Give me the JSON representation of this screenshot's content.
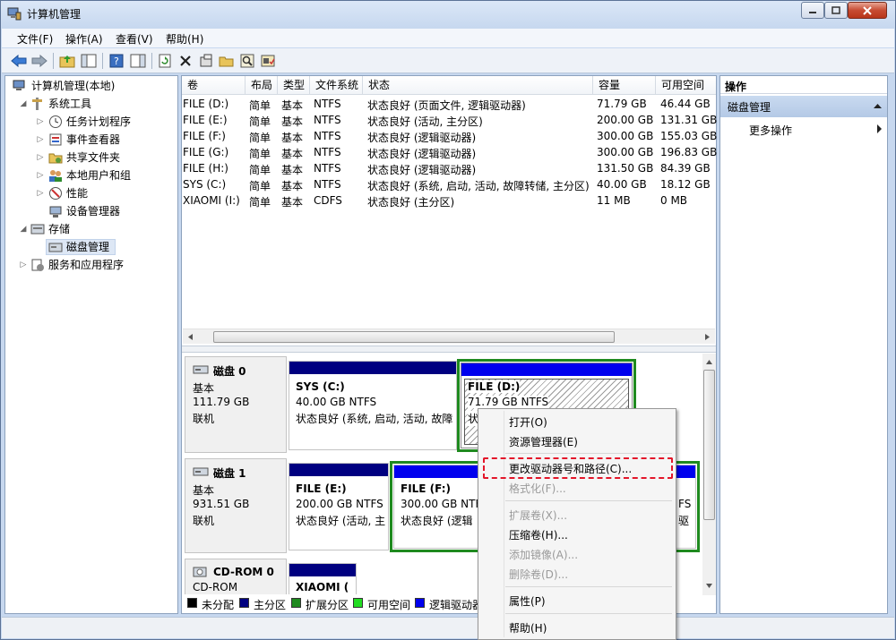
{
  "window": {
    "title": "计算机管理"
  },
  "menu": [
    "文件(F)",
    "操作(A)",
    "查看(V)",
    "帮助(H)"
  ],
  "tree": [
    {
      "label": "计算机管理(本地)",
      "icon": "computer-icon"
    },
    {
      "label": "系统工具",
      "icon": "tools-icon"
    },
    {
      "label": "任务计划程序",
      "icon": "clock-icon"
    },
    {
      "label": "事件查看器",
      "icon": "event-viewer-icon"
    },
    {
      "label": "共享文件夹",
      "icon": "shared-folder-icon"
    },
    {
      "label": "本地用户和组",
      "icon": "users-icon"
    },
    {
      "label": "性能",
      "icon": "performance-icon"
    },
    {
      "label": "设备管理器",
      "icon": "device-manager-icon"
    },
    {
      "label": "存储",
      "icon": "storage-icon"
    },
    {
      "label": "磁盘管理",
      "icon": "disk-management-icon"
    },
    {
      "label": "服务和应用程序",
      "icon": "services-icon"
    }
  ],
  "volume_list": {
    "headers": [
      "卷",
      "布局",
      "类型",
      "文件系统",
      "状态",
      "容量",
      "可用空间"
    ],
    "rows": [
      {
        "vol": "FILE (D:)",
        "layout": "简单",
        "type": "基本",
        "fs": "NTFS",
        "status": "状态良好 (页面文件, 逻辑驱动器)",
        "cap": "71.79 GB",
        "free": "46.44 GB"
      },
      {
        "vol": "FILE (E:)",
        "layout": "简单",
        "type": "基本",
        "fs": "NTFS",
        "status": "状态良好 (活动, 主分区)",
        "cap": "200.00 GB",
        "free": "131.31 GB"
      },
      {
        "vol": "FILE (F:)",
        "layout": "简单",
        "type": "基本",
        "fs": "NTFS",
        "status": "状态良好 (逻辑驱动器)",
        "cap": "300.00 GB",
        "free": "155.03 GB"
      },
      {
        "vol": "FILE (G:)",
        "layout": "简单",
        "type": "基本",
        "fs": "NTFS",
        "status": "状态良好 (逻辑驱动器)",
        "cap": "300.00 GB",
        "free": "196.83 GB"
      },
      {
        "vol": "FILE (H:)",
        "layout": "简单",
        "type": "基本",
        "fs": "NTFS",
        "status": "状态良好 (逻辑驱动器)",
        "cap": "131.50 GB",
        "free": "84.39 GB"
      },
      {
        "vol": "SYS (C:)",
        "layout": "简单",
        "type": "基本",
        "fs": "NTFS",
        "status": "状态良好 (系统, 启动, 活动, 故障转储, 主分区)",
        "cap": "40.00 GB",
        "free": "18.12 GB"
      },
      {
        "vol": "XIAOMI (I:)",
        "layout": "简单",
        "type": "基本",
        "fs": "CDFS",
        "status": "状态良好 (主分区)",
        "cap": "11 MB",
        "free": "0 MB"
      }
    ]
  },
  "disks": {
    "disk0": {
      "name": "磁盘 0",
      "type": "基本",
      "size": "111.79 GB",
      "state": "联机",
      "p1": {
        "name": "SYS  (C:)",
        "line1": "40.00 GB NTFS",
        "line2": "状态良好 (系统, 启动, 活动, 故障"
      },
      "p2": {
        "name": "FILE  (D:)",
        "line1": "71.79 GB NTFS",
        "line2": "状"
      }
    },
    "disk1": {
      "name": "磁盘 1",
      "type": "基本",
      "size": "931.51 GB",
      "state": "联机",
      "p1": {
        "name": "FILE  (E:)",
        "line1": "200.00 GB NTFS",
        "line2": "状态良好 (活动, 主"
      },
      "p2": {
        "name": "FILE  (F:)",
        "line1": "300.00 GB NTFS",
        "line2": "状态良好 (逻辑"
      },
      "p3_frag1": "FS",
      "p3_frag2": "驱"
    },
    "cdrom": {
      "name": "CD-ROM 0",
      "type": "CD-ROM",
      "p1": {
        "name": "XIAOMI  ("
      }
    }
  },
  "legend": [
    {
      "label": "未分配",
      "color": "#000000"
    },
    {
      "label": "主分区",
      "color": "#000080"
    },
    {
      "label": "扩展分区",
      "color": "#1f8a1f"
    },
    {
      "label": "可用空间",
      "color": "#22dd22"
    },
    {
      "label": "逻辑驱动器",
      "color": "#0000ee"
    }
  ],
  "actions": {
    "header": "操作",
    "group": "磁盘管理",
    "more": "更多操作"
  },
  "context_menu": [
    {
      "label": "打开(O)",
      "enabled": true
    },
    {
      "label": "资源管理器(E)",
      "enabled": true
    },
    {
      "label": "更改驱动器号和路径(C)...",
      "enabled": true,
      "highlighted": true
    },
    {
      "label": "格式化(F)...",
      "enabled": false
    },
    {
      "label": "扩展卷(X)...",
      "enabled": false
    },
    {
      "label": "压缩卷(H)...",
      "enabled": true
    },
    {
      "label": "添加镜像(A)...",
      "enabled": false
    },
    {
      "label": "删除卷(D)...",
      "enabled": false
    },
    {
      "label": "属性(P)",
      "enabled": true
    },
    {
      "label": "帮助(H)",
      "enabled": true
    }
  ],
  "colors": {
    "primary": "#000080",
    "logical": "#0000ee",
    "extended": "#1f8a1f",
    "highlight": "#e3162a"
  }
}
